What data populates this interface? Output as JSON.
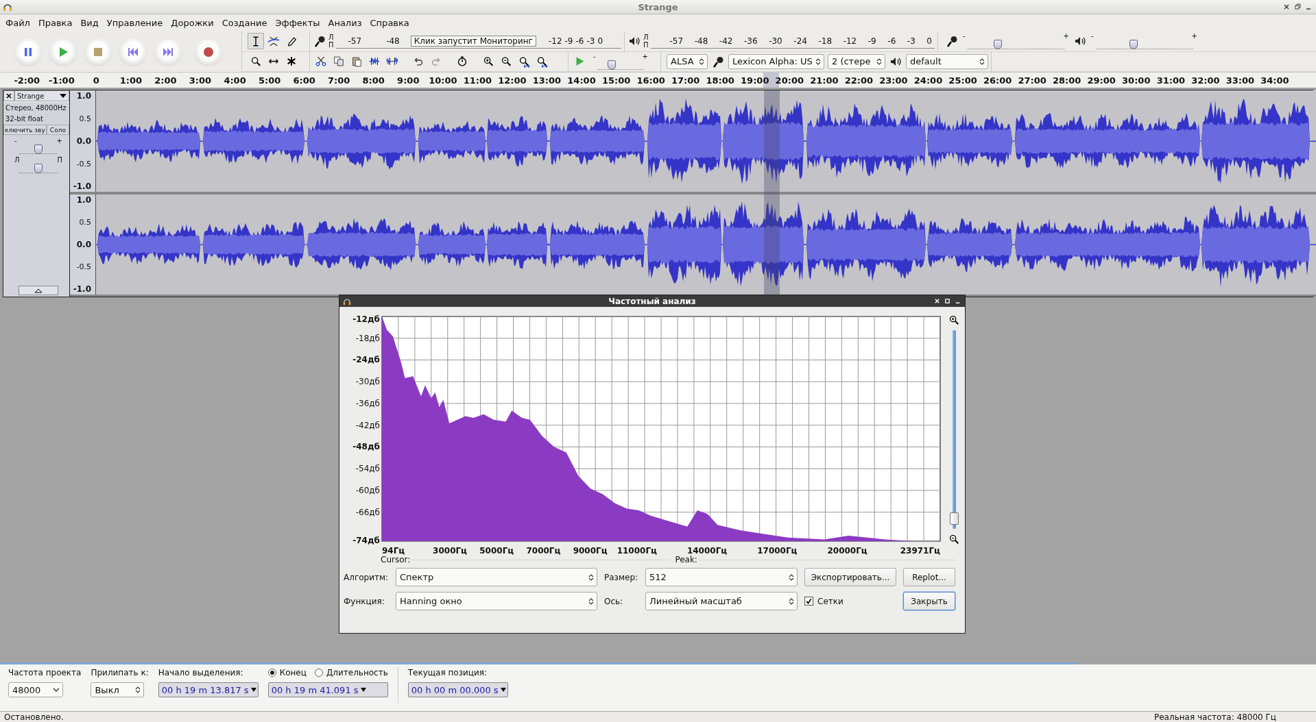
{
  "window": {
    "title": "Strange"
  },
  "menu": [
    "Файл",
    "Правка",
    "Вид",
    "Управление",
    "Дорожки",
    "Создание",
    "Эффекты",
    "Анализ",
    "Справка"
  ],
  "record_meter": {
    "channels": [
      "Л",
      "П"
    ],
    "scale_start": [
      "-57",
      "-48"
    ],
    "notice": "Клик запустит Мониторинг",
    "scale_end": [
      "-12",
      "-9",
      "-6",
      "-3",
      "0"
    ]
  },
  "playback_meter": {
    "channels": [
      "Л",
      "П"
    ],
    "scale": [
      "-57",
      "-48",
      "-42",
      "-36",
      "-30",
      "-24",
      "-18",
      "-12",
      "-9",
      "-6",
      "-3",
      "0"
    ]
  },
  "mixer": {
    "record": {
      "min": "-",
      "max": "+",
      "level": 0.31
    },
    "playback": {
      "min": "-",
      "max": "+",
      "level": 0.39
    }
  },
  "play_at_speed": {
    "min": "-",
    "max": "+",
    "level": 0.31
  },
  "devices": {
    "host": "ALSA",
    "input": "Lexicon Alpha: US",
    "channels": "2 (стере",
    "output": "default"
  },
  "ruler": {
    "ticks": [
      "-2:00",
      "-1:00",
      "0",
      "1:00",
      "2:00",
      "3:00",
      "4:00",
      "5:00",
      "6:00",
      "7:00",
      "8:00",
      "9:00",
      "10:00",
      "11:00",
      "12:00",
      "13:00",
      "14:00",
      "15:00",
      "16:00",
      "17:00",
      "18:00",
      "19:00",
      "20:00",
      "21:00",
      "22:00",
      "23:00",
      "24:00",
      "25:00",
      "26:00",
      "27:00",
      "28:00",
      "29:00",
      "30:00",
      "31:00",
      "32:00",
      "33:00",
      "34:00"
    ]
  },
  "track": {
    "name": "Strange",
    "info": [
      "Стерео, 48000Hz",
      "32-bit float"
    ],
    "mute": "ключить зву",
    "solo": "Соло",
    "gain": {
      "min": "-",
      "max": "+",
      "level": 0.5
    },
    "pan": {
      "min": "Л",
      "max": "П",
      "level": 0.5
    },
    "channels": [
      {
        "scale": [
          "1.0",
          "0.5",
          "0.0",
          "-0.5",
          "-1.0"
        ]
      },
      {
        "scale": [
          "1.0",
          "0.5",
          "0.0",
          "-0.5",
          "-1.0"
        ]
      }
    ]
  },
  "dialog": {
    "title": "Частотный анализ",
    "chart_data": {
      "type": "area",
      "x": [
        94,
        94,
        301,
        560,
        905,
        1077,
        1422,
        1767,
        1940,
        2199,
        2371,
        2544,
        2716,
        2975,
        3320,
        3665,
        4010,
        4441,
        4872,
        5390,
        5648,
        6080,
        6425,
        6942,
        7460,
        7977,
        8495,
        9012,
        9530,
        10047,
        10565,
        11082,
        11600,
        12117,
        12635,
        13152,
        13584,
        14015,
        14446,
        15395,
        16430,
        17465,
        19017,
        20052,
        21605,
        22813,
        23675
      ],
      "values": [
        -74,
        -12,
        -15.7,
        -17.5,
        -24.5,
        -29,
        -28.5,
        -34,
        -31,
        -34.5,
        -33,
        -37,
        -35,
        -41.5,
        -40.5,
        -39.5,
        -40,
        -39,
        -40.5,
        -41,
        -38,
        -40,
        -40.5,
        -45,
        -48,
        -49.5,
        -56,
        -59.5,
        -61,
        -63.5,
        -65,
        -65.5,
        -67,
        -68,
        -69,
        -70,
        -65.5,
        -66.5,
        -69.5,
        -71,
        -72,
        -73,
        -73.5,
        -72.5,
        -73.5,
        -74,
        -74
      ],
      "xlim": [
        94,
        23971
      ],
      "ylim": [
        -74,
        -12
      ],
      "grid": true,
      "xticks": [
        {
          "value": 94,
          "label": "94Гц"
        },
        {
          "value": 3000,
          "label": "3000Гц"
        },
        {
          "value": 5000,
          "label": "5000Гц"
        },
        {
          "value": 7000,
          "label": "7000Гц"
        },
        {
          "value": 9000,
          "label": "9000Гц"
        },
        {
          "value": 11000,
          "label": "11000Гц"
        },
        {
          "value": 14000,
          "label": "14000Гц"
        },
        {
          "value": 17000,
          "label": "17000Гц"
        },
        {
          "value": 20000,
          "label": "20000Гц"
        },
        {
          "value": 23971,
          "label": "23971Гц"
        }
      ],
      "yticks": [
        {
          "value": -12,
          "label": "**-12дб**"
        },
        {
          "value": -18,
          "label": "-18дб"
        },
        {
          "value": -24,
          "label": "**-24дб**"
        },
        {
          "value": -30,
          "label": "-30дб"
        },
        {
          "value": -36,
          "label": "-36дб"
        },
        {
          "value": -42,
          "label": "-42дб"
        },
        {
          "value": -48,
          "label": "**-48дб**"
        },
        {
          "value": -54,
          "label": "-54дб"
        },
        {
          "value": -60,
          "label": "-60дб"
        },
        {
          "value": -66,
          "label": "-66дб"
        },
        {
          "value": -74,
          "label": "**-74дб**"
        }
      ]
    },
    "zoom": {
      "level": 0.05
    },
    "cursor_label": "Cursor:",
    "peak_label": "Peak:",
    "controls": [
      {
        "label": "Алгоритм:",
        "value": "Спектр"
      },
      {
        "label": "Размер:",
        "value": "512"
      },
      {
        "label": "Функция:",
        "value": "Hanning окно"
      },
      {
        "label": "Ось:",
        "value": "Линейный масштаб"
      }
    ],
    "grid": {
      "label": "Сетки",
      "checked": true
    },
    "buttons": [
      {
        "label": "Экспортировать...",
        "default": false
      },
      {
        "label": "Replot...",
        "default": false
      },
      {
        "label": "Закрыть",
        "default": true
      }
    ]
  },
  "selection_toolbar": {
    "rate": {
      "label": "Частота проекта",
      "value": "48000"
    },
    "snap": {
      "label": "Прилипать к:",
      "value": "Выкл"
    },
    "start": {
      "label": "Начало выделения:",
      "value": "00 h 19 m 13.817 s"
    },
    "end_mode": [
      {
        "label": "Конец",
        "selected": true
      },
      {
        "label": "Длительность",
        "selected": false
      }
    ],
    "end": {
      "value": "00 h 19 m 41.091 s"
    },
    "position": {
      "label": "Текущая позиция:",
      "value": "00 h 00 m 00.000 s"
    }
  },
  "status_bar": {
    "state": "Остановлено.",
    "rate": "Реальная частота: 48000 Гц"
  }
}
